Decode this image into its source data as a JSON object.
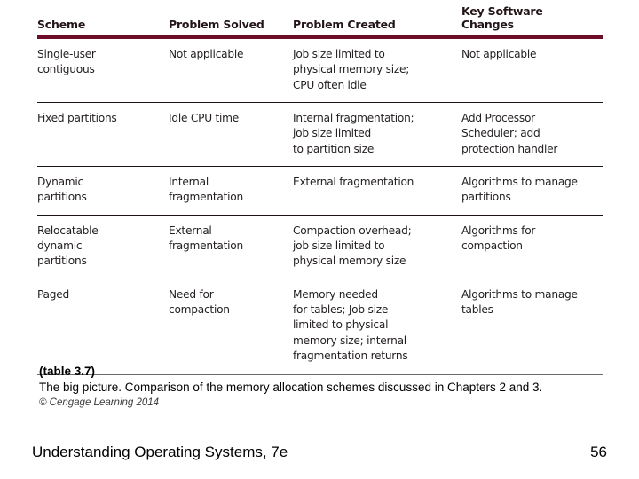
{
  "slide": {
    "background_color": "#ffffff",
    "header_rule_color": "#6d0d28",
    "row_rule_color": "#1a1213"
  },
  "table": {
    "headers": [
      "Scheme",
      "Problem Solved",
      "Problem Created",
      "Key Software Changes"
    ],
    "rows": [
      {
        "scheme": "Single-user\ncontiguous",
        "problem_solved": "Not applicable",
        "problem_created": "Job size limited to\nphysical memory size;\nCPU often idle",
        "key_software_changes": "Not applicable"
      },
      {
        "scheme": "Fixed partitions",
        "problem_solved": "Idle CPU time",
        "problem_created": "Internal fragmentation;\njob size limited\nto partition size",
        "key_software_changes": "Add Processor\nScheduler; add\nprotection handler"
      },
      {
        "scheme": "Dynamic\npartitions",
        "problem_solved": "Internal\nfragmentation",
        "problem_created": "External fragmentation",
        "key_software_changes": "Algorithms to manage\npartitions"
      },
      {
        "scheme": "Relocatable\ndynamic\npartitions",
        "problem_solved": "External\nfragmentation",
        "problem_created": "Compaction overhead;\njob size limited to\nphysical memory size",
        "key_software_changes": "Algorithms for\ncompaction"
      },
      {
        "scheme": "Paged",
        "problem_solved": "Need for\ncompaction",
        "problem_created": "Memory needed\nfor tables; Job size\nlimited to physical\nmemory size; internal\nfragmentation returns",
        "key_software_changes": "Algorithms to manage\ntables"
      }
    ]
  },
  "caption": {
    "label": "(table 3.7)",
    "text": "The big picture. Comparison of the memory allocation schemes discussed in Chapters 2 and 3.",
    "credit": "© Cengage Learning 2014"
  },
  "footer": {
    "title": "Understanding Operating Systems, 7e",
    "page_number": "56"
  }
}
